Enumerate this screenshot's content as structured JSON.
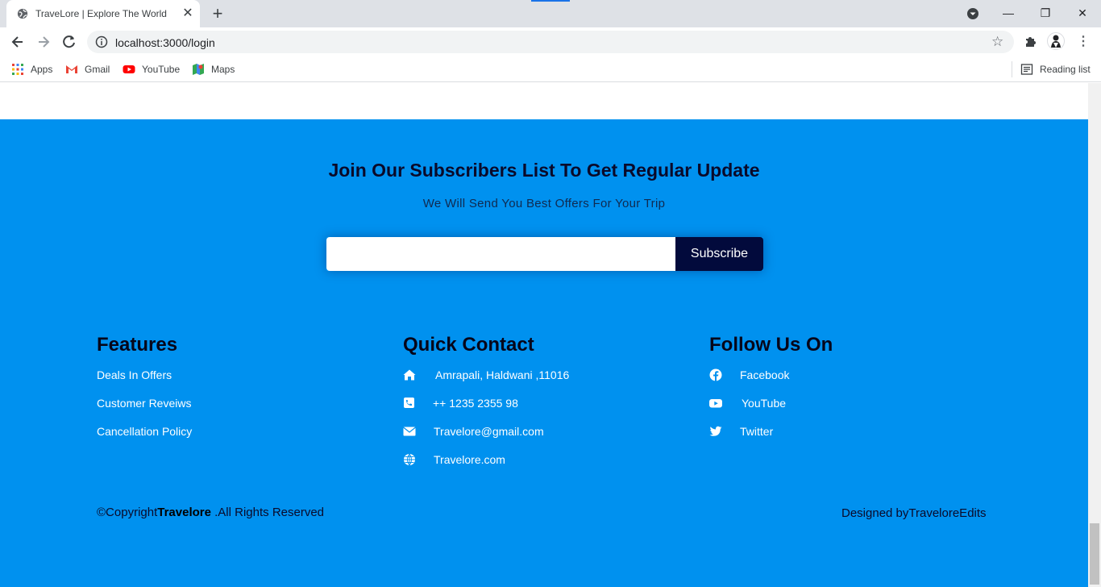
{
  "browser": {
    "tab_title": "TraveLore | Explore The World",
    "url": "localhost:3000/login",
    "bookmarks": [
      {
        "label": "Apps",
        "icon": "apps-grid-icon"
      },
      {
        "label": "Gmail",
        "icon": "gmail-icon"
      },
      {
        "label": "YouTube",
        "icon": "youtube-icon"
      },
      {
        "label": "Maps",
        "icon": "maps-icon"
      }
    ],
    "reading_list": "Reading list"
  },
  "subscribe": {
    "heading": "Join Our Subscribers List To Get Regular Update",
    "subtext": "We Will Send You Best Offers For Your Trip",
    "input_placeholder": "",
    "button_label": "Subscribe"
  },
  "features": {
    "title": "Features",
    "items": [
      "Deals In Offers",
      "Customer Reveiws",
      "Cancellation Policy"
    ]
  },
  "contact": {
    "title": "Quick Contact",
    "items": [
      {
        "icon": "home-icon",
        "text": "Amrapali, Haldwani ,11016"
      },
      {
        "icon": "phone-icon",
        "text": "++ 1235 2355 98"
      },
      {
        "icon": "envelope-icon",
        "text": "Travelore@gmail.com"
      },
      {
        "icon": "globe-icon",
        "text": "Travelore.com"
      }
    ]
  },
  "follow": {
    "title": "Follow Us On",
    "items": [
      {
        "icon": "facebook-icon",
        "text": "Facebook"
      },
      {
        "icon": "youtube-icon",
        "text": "YouTube"
      },
      {
        "icon": "twitter-icon",
        "text": "Twitter"
      }
    ]
  },
  "bottom": {
    "copyright_prefix": "©Copyright",
    "copyright_brand": "Travelore",
    "copyright_suffix": " .All Rights Reserved",
    "designed_by": "Designed byTraveloreEdits"
  },
  "colors": {
    "footer_bg": "#0091ef",
    "button_bg": "#020a3c",
    "heading_text": "#0a0a2a"
  }
}
